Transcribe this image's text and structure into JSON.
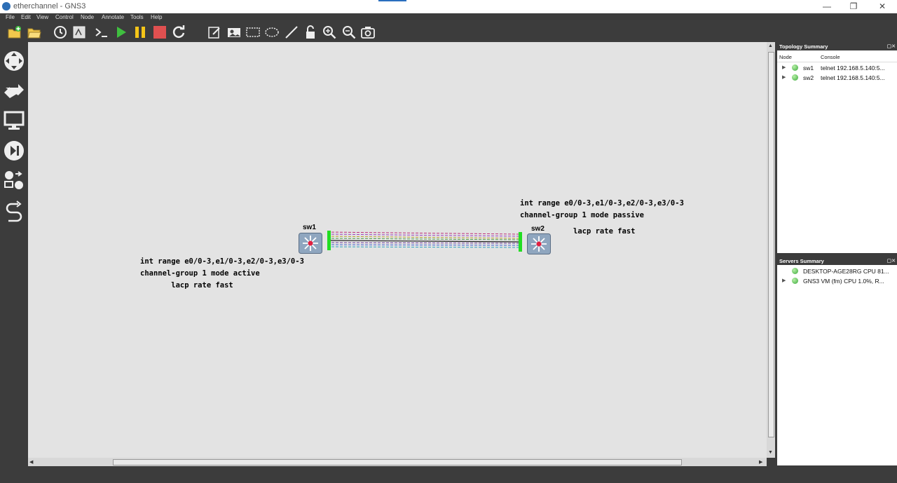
{
  "window": {
    "title": "etherchannel - GNS3",
    "minimize": "—",
    "restore": "❐",
    "close": "✕"
  },
  "menu": [
    "File",
    "Edit",
    "View",
    "Control",
    "Node",
    "Annotate",
    "Tools",
    "Help"
  ],
  "toolbar_icons": [
    "new-project-icon",
    "open-project-icon",
    "snapshot-icon",
    "show-interface-labels-icon",
    "console-all-icon",
    "start-all-icon",
    "suspend-all-icon",
    "stop-all-icon",
    "reload-all-icon",
    "add-note-icon",
    "insert-image-icon",
    "draw-rectangle-icon",
    "draw-ellipse-icon",
    "draw-line-icon",
    "lock-items-icon",
    "zoom-in-icon",
    "zoom-out-icon",
    "screenshot-icon"
  ],
  "left_toolbar_icons": [
    "routers-icon",
    "switches-icon",
    "end-devices-icon",
    "security-devices-icon",
    "all-devices-icon",
    "add-link-icon"
  ],
  "colors": {
    "start": "#3fbf3f",
    "suspend": "#f5c518",
    "stop": "#e05050",
    "link_port": "#22dd22"
  },
  "canvas": {
    "nodes": [
      {
        "name": "sw1"
      },
      {
        "name": "sw2"
      }
    ],
    "notes": {
      "sw1_config": "int range e0/0-3,e1/0-3,e2/0-3,e3/0-3\nchannel-group 1 mode active\n       lacp rate fast",
      "sw2_config_line1": "int range e0/0-3,e1/0-3,e2/0-3,e3/0-3",
      "sw2_config_line2": "channel-group 1 mode passive",
      "sw2_config_line3": "lacp rate fast"
    }
  },
  "topology_summary": {
    "title": "Topology Summary",
    "col_node": "Node",
    "col_console": "Console",
    "rows": [
      {
        "node": "sw1",
        "console": "telnet 192.168.5.140:5..."
      },
      {
        "node": "sw2",
        "console": "telnet 192.168.5.140:5..."
      }
    ]
  },
  "servers_summary": {
    "title": "Servers Summary",
    "rows": [
      {
        "name": "DESKTOP-AGE28RG CPU 81..."
      },
      {
        "name": "GNS3 VM (fm) CPU 1.0%, R..."
      }
    ]
  }
}
